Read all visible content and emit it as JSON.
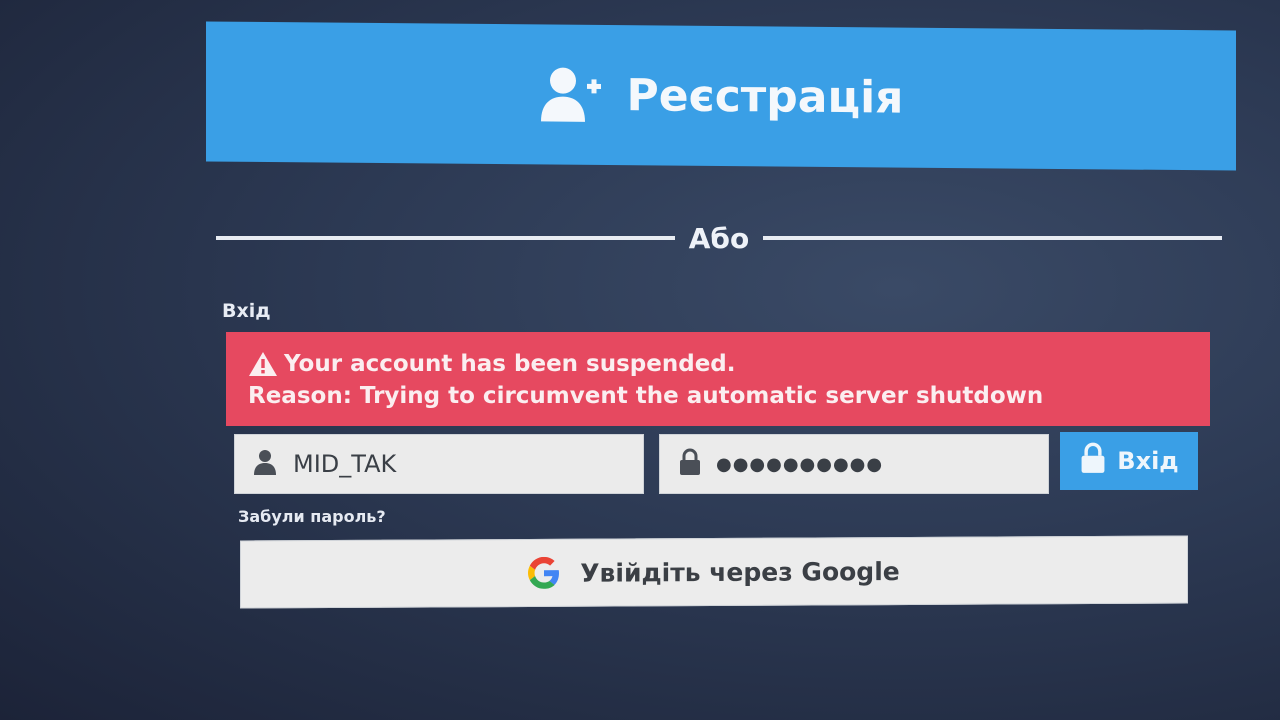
{
  "register": {
    "label": "Реєстрація",
    "icon": "add-user-icon"
  },
  "divider": {
    "text": "Або"
  },
  "login": {
    "heading": "Вхід",
    "alert": {
      "line1": "Your account has been suspended.",
      "line2": "Reason: Trying to circumvent the automatic server shutdown",
      "icon": "warning-icon",
      "color": "#e64960"
    },
    "username": {
      "value": "MID_TAK",
      "icon": "user-icon"
    },
    "password": {
      "value": "●●●●●●●●●●",
      "icon": "lock-icon"
    },
    "submit_label": "Вхід",
    "forgot_label": "Забули пароль?",
    "google_label": "Увійдіть через Google"
  },
  "colors": {
    "accent": "#3a9fe6",
    "error": "#e64960",
    "background": "#2c3953"
  }
}
